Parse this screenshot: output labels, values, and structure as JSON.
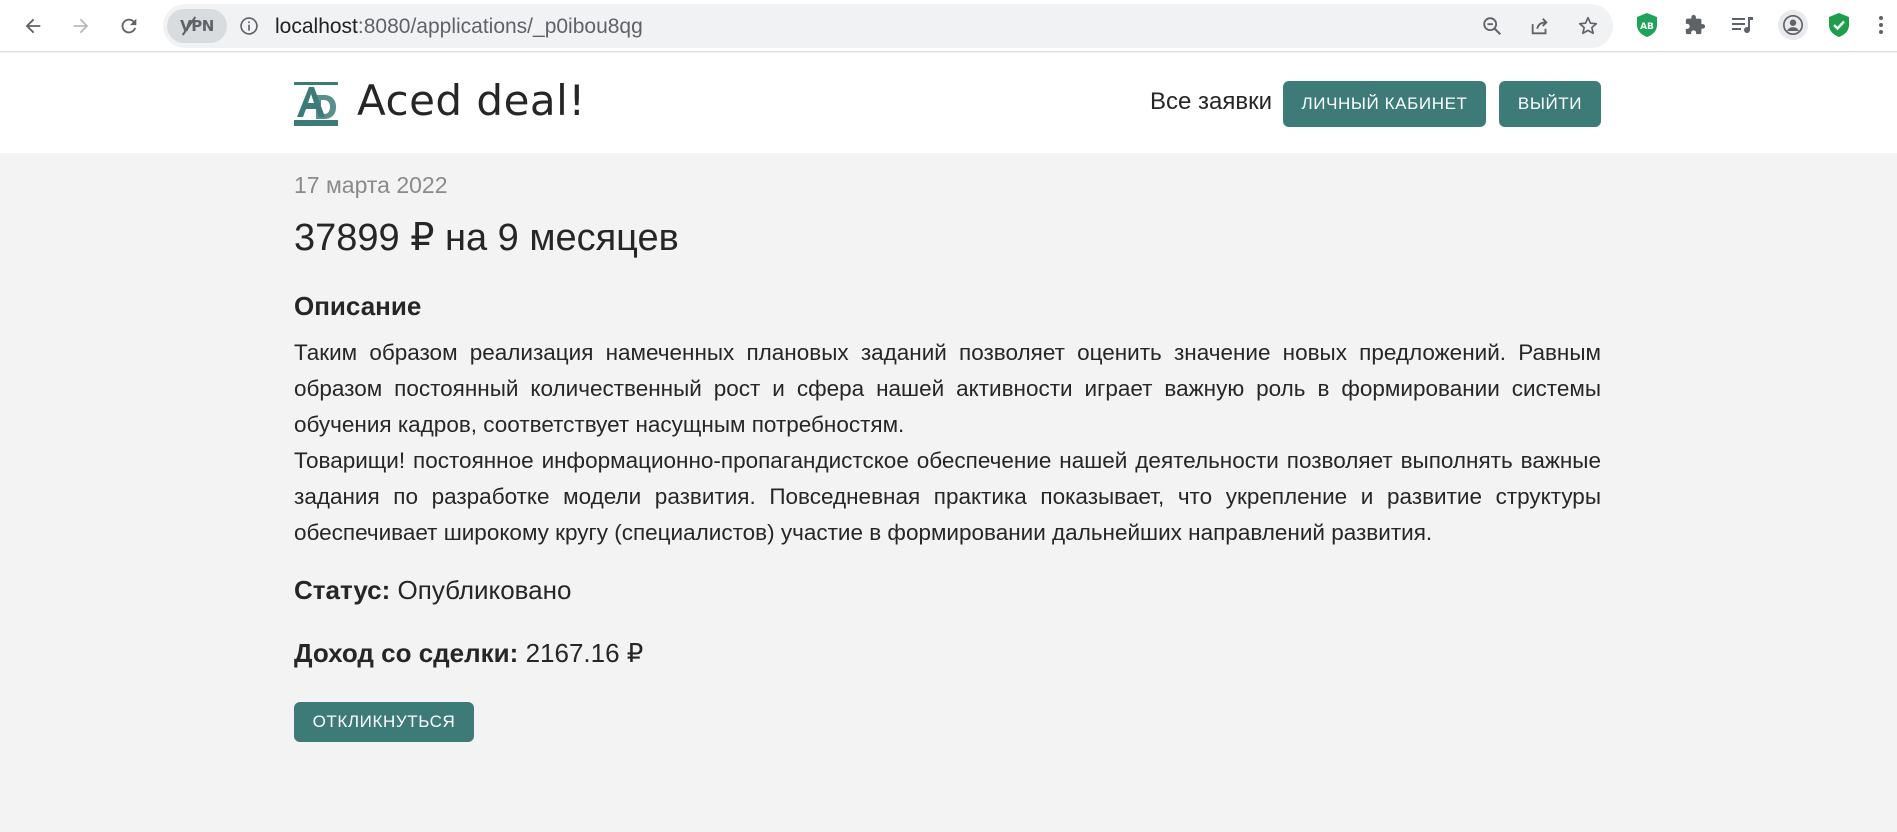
{
  "browser": {
    "vpn_label": "VPN",
    "url_host": "localhost",
    "url_rest": ":8080/applications/_p0ibou8qg"
  },
  "header": {
    "brand": "Aced deal!",
    "nav_all_requests": "Все заявки",
    "cabinet_button": "ЛИЧНЫЙ КАБИНЕТ",
    "logout_button": "ВЫЙТИ"
  },
  "application": {
    "date": "17 марта 2022",
    "amount_title": "37899 ₽ на 9 месяцев",
    "description_heading": "Описание",
    "description_paragraphs": [
      "Таким образом реализация намеченных плановых заданий позволяет оценить значение новых предложений. Равным образом постоянный количественный рост и сфера нашей активности играет важную роль в формировании системы обучения кадров, соответствует насущным потребностям.",
      "Товарищи! постоянное информационно-пропагандистское обеспечение нашей деятельности позволяет выполнять важные задания по разработке модели развития. Повседневная практика показывает, что укрепление и развитие структуры обеспечивает широкому кругу (специалистов) участие в формировании дальнейших направлений развития."
    ],
    "status_label": "Статус:",
    "status_value": "Опубликовано",
    "income_label": "Доход со сделки:",
    "income_value": "2167.16 ₽",
    "respond_button": "ОТКЛИКНУТЬСЯ"
  },
  "colors": {
    "accent": "#3d7b78",
    "page_background": "#f3f3f3",
    "header_background": "#ffffff"
  },
  "icons": [
    "back-icon",
    "forward-icon",
    "reload-icon",
    "info-icon",
    "zoom-out-icon",
    "share-icon",
    "star-icon",
    "adblock-icon",
    "extensions-icon",
    "media-icon",
    "profile-icon",
    "shield-check-icon",
    "menu-icon"
  ]
}
